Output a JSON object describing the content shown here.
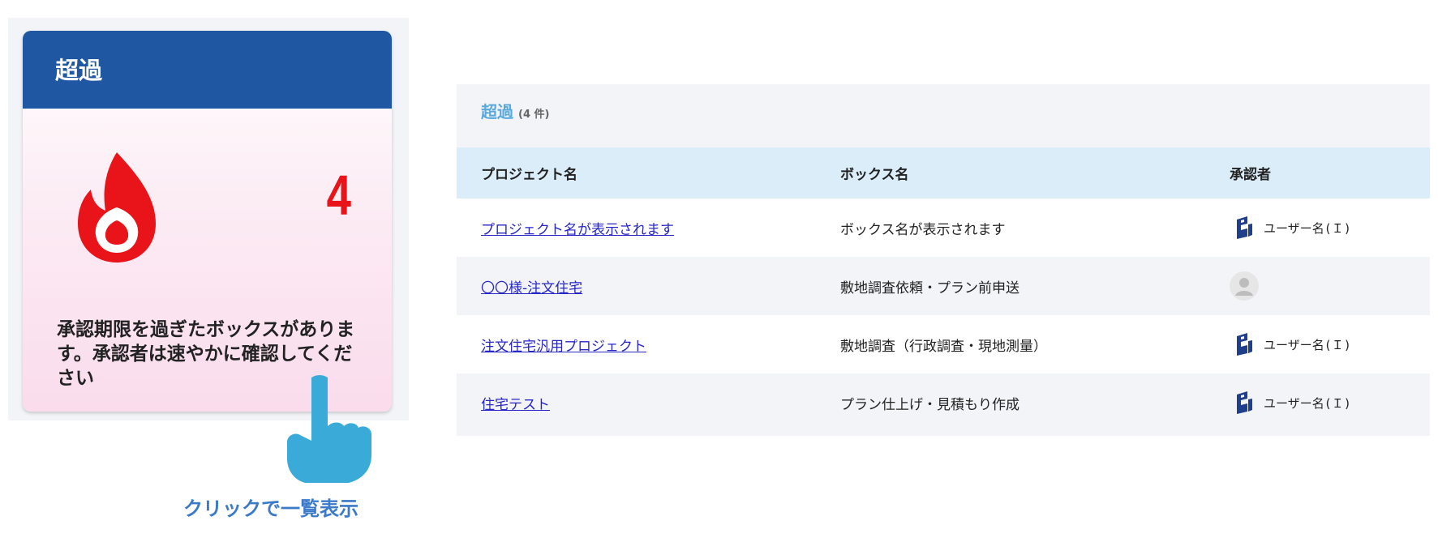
{
  "card": {
    "title": "超過",
    "count": "4",
    "message": "承認期限を過ぎたボックスがあります。承認者は速やかに確認してください",
    "icon": "flame-icon",
    "accent_color": "#1f57a2",
    "count_color": "#e8141a"
  },
  "hint": {
    "label": "クリックで一覧表示",
    "icon": "pointing-hand-icon"
  },
  "panel": {
    "title": "超過",
    "count_label": "(4 件)"
  },
  "table": {
    "columns": [
      "プロジェクト名",
      "ボックス名",
      "承認者"
    ],
    "rows": [
      {
        "project": "プロジェクト名が表示されます",
        "box": "ボックス名が表示されます",
        "approver": "ユーザー名(Ｉ)",
        "approver_icon": "b-logo-icon"
      },
      {
        "project": "〇〇様-注文住宅",
        "box": "敷地調査依頼・プラン前申送",
        "approver": "",
        "approver_icon": "default-avatar-icon"
      },
      {
        "project": "注文住宅汎用プロジェクト",
        "box": "敷地調査（行政調査・現地測量）",
        "approver": "ユーザー名(Ｉ)",
        "approver_icon": "b-logo-icon"
      },
      {
        "project": "住宅テスト",
        "box": "プラン仕上げ・見積もり作成",
        "approver": "ユーザー名(Ｉ)",
        "approver_icon": "b-logo-icon"
      }
    ]
  }
}
